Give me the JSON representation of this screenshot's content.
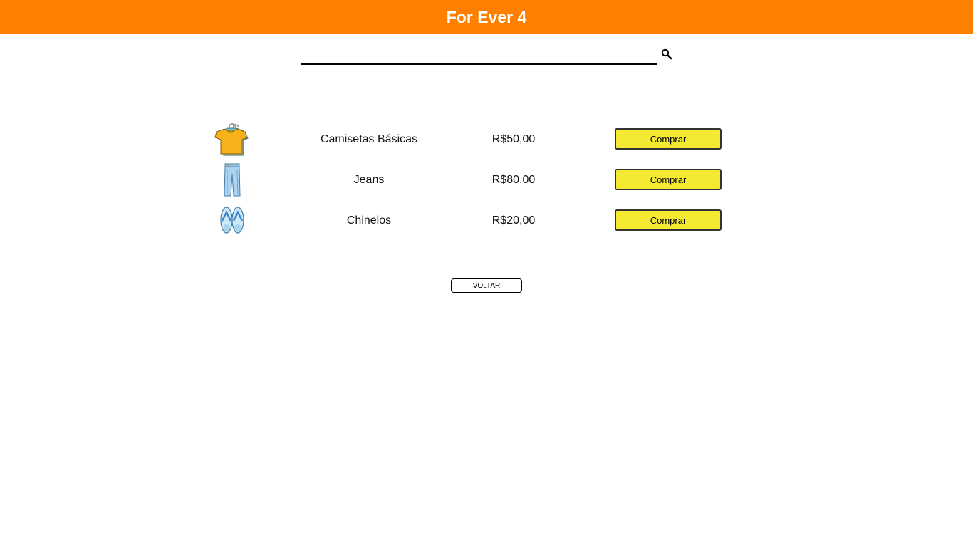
{
  "header": {
    "title": "For Ever 4",
    "background": "#ff7f00"
  },
  "search": {
    "value": "",
    "placeholder": "",
    "icon": "search-icon"
  },
  "products": [
    {
      "name": "Camisetas Básicas",
      "price": "R$50,00",
      "button_label": "Comprar",
      "icon": "tshirt-icon"
    },
    {
      "name": "Jeans",
      "price": "R$80,00",
      "button_label": "Comprar",
      "icon": "jeans-icon"
    },
    {
      "name": "Chinelos",
      "price": "R$20,00",
      "button_label": "Comprar",
      "icon": "flip-flops-icon"
    }
  ],
  "back_button": {
    "label": "VOLTAR"
  },
  "colors": {
    "accent": "#ff7f00",
    "buy_button": "#f5ea32"
  }
}
